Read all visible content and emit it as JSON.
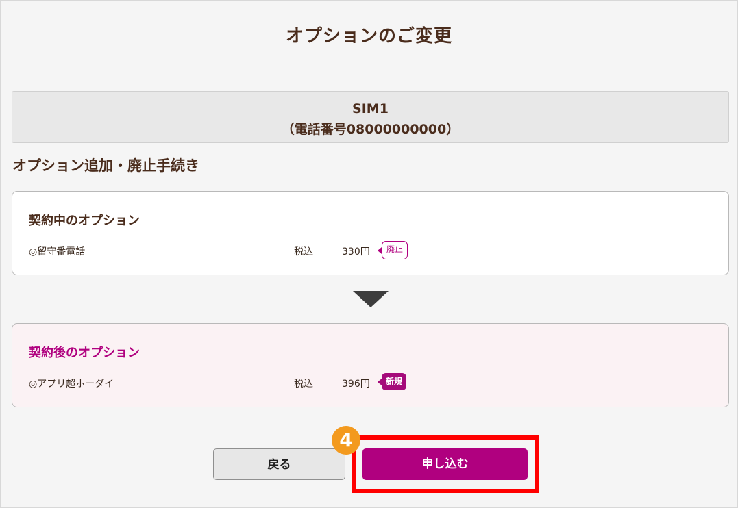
{
  "page": {
    "title": "オプションのご変更"
  },
  "sim": {
    "name": "SIM1",
    "phone": "（電話番号08000000000）"
  },
  "section_heading": "オプション追加・廃止手続き",
  "current_options": {
    "title": "契約中のオプション",
    "items": [
      {
        "name": "◎留守番電話",
        "tax_label": "税込",
        "price": "330円",
        "badge": "廃止"
      }
    ]
  },
  "after_options": {
    "title": "契約後のオプション",
    "items": [
      {
        "name": "◎アプリ超ホーダイ",
        "tax_label": "税込",
        "price": "396円",
        "badge": "新規"
      }
    ]
  },
  "buttons": {
    "back": "戻る",
    "apply": "申し込む"
  },
  "step": {
    "number": "4"
  },
  "colors": {
    "accent": "#b0007f",
    "highlight": "#ff0000",
    "step_badge": "#f39a1e",
    "heading": "#4a2c1c"
  },
  "icons": {
    "arrow": "arrow-down-icon"
  }
}
